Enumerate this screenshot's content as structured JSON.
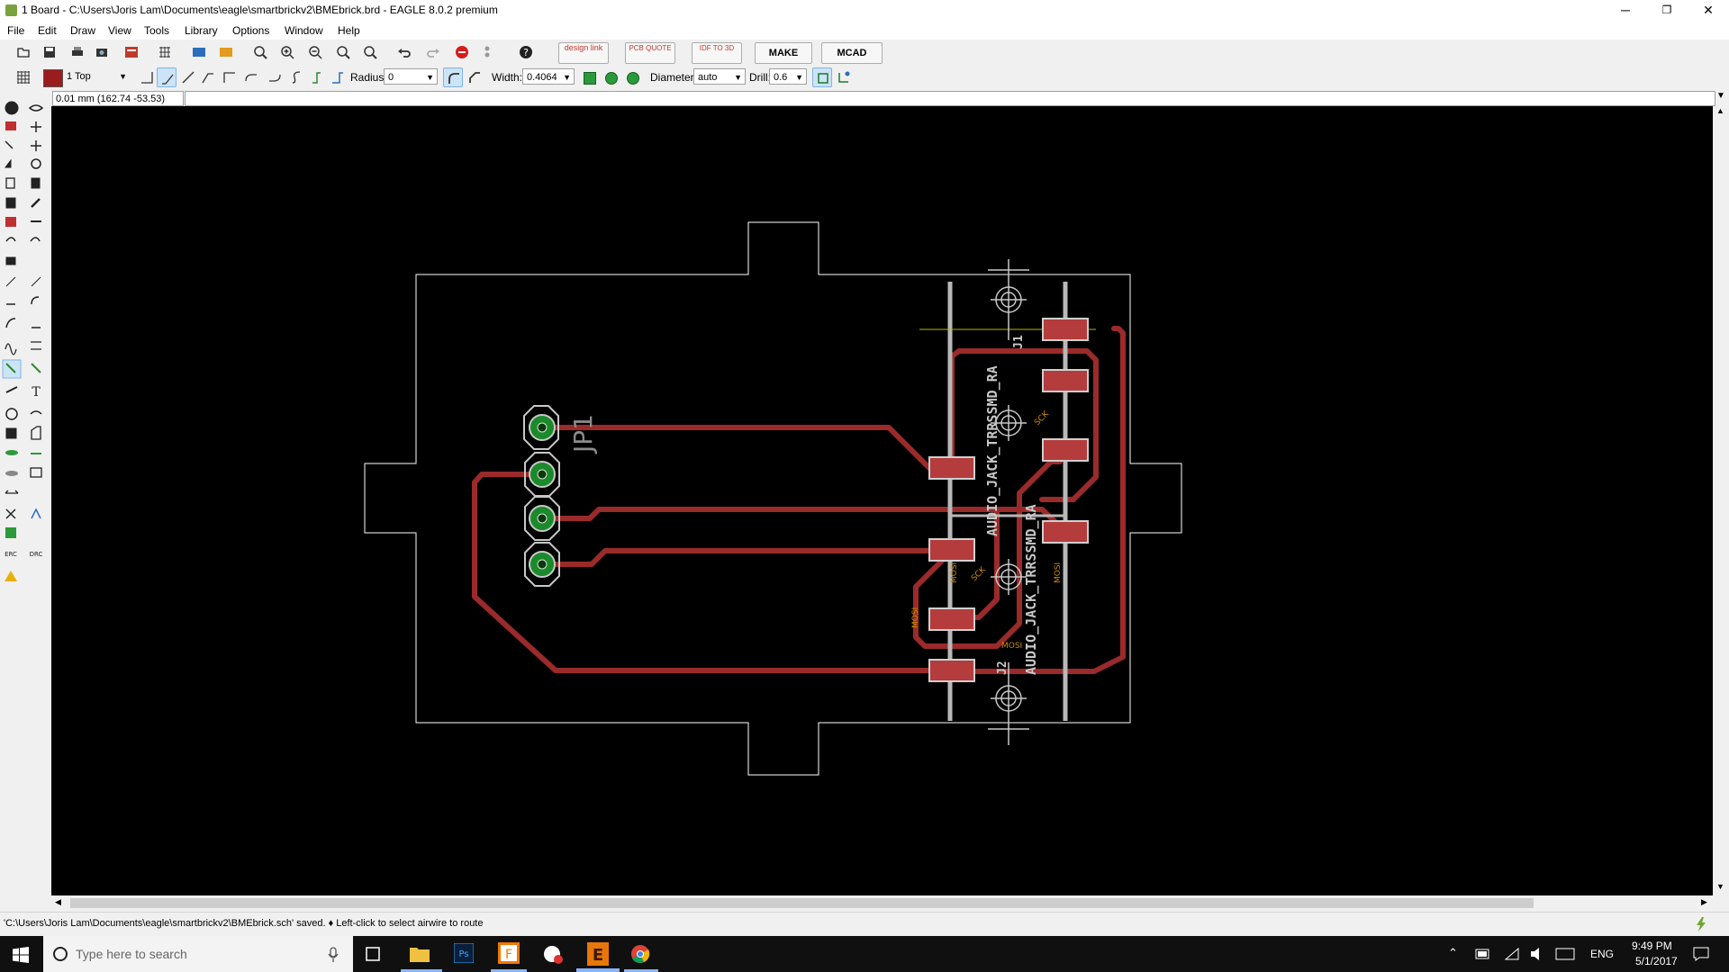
{
  "window": {
    "title": "1 Board - C:\\Users\\Joris Lam\\Documents\\eagle\\smartbrickv2\\BMEbrick.brd - EAGLE 8.0.2 premium",
    "minimize": "─",
    "restore": "❐",
    "close": "✕"
  },
  "menu": [
    {
      "label": "File"
    },
    {
      "label": "Edit"
    },
    {
      "label": "Draw"
    },
    {
      "label": "View"
    },
    {
      "label": "Tools"
    },
    {
      "label": "Library"
    },
    {
      "label": "Options"
    },
    {
      "label": "Window"
    },
    {
      "label": "Help"
    }
  ],
  "toolbar1": {
    "design_link": "design link",
    "pcb_quote": "PCB QUOTE",
    "idf_3d": "IDF TO 3D",
    "make": "MAKE",
    "mcad": "MCAD"
  },
  "toolbar2": {
    "layer": "1 Top",
    "radius_label": "Radius:",
    "radius_value": "0",
    "width_label": "Width:",
    "width_value": "0.4064",
    "diameter_label": "Diameter:",
    "diameter_value": "auto",
    "drill_label": "Drill:",
    "drill_value": "0.6"
  },
  "coords": "0.01 mm (162.74 -53.53)",
  "board": {
    "header_label": "JP1",
    "jack1_name": "J1",
    "jack1_value": "AUDIO_JACK_TRRSSMD_RA",
    "jack2_name": "J2",
    "jack2_value": "AUDIO_JACK_TRRSSMD_RA",
    "signal_sck": "SCK",
    "signal_mosi": "MOSI"
  },
  "colors": {
    "canvas": "#000000",
    "trace": "#9b2a2a",
    "pad_fill": "#b43c3c",
    "pad_ring": "#b0b0b0",
    "via_green": "#1a8a2a",
    "outline": "#ffffff",
    "silk": "#c8c8c8"
  },
  "status": "'C:\\Users\\Joris Lam\\Documents\\eagle\\smartbrickv2\\BMEbrick.sch' saved.  ♦ Left-click to select airwire to route",
  "taskbar": {
    "search_placeholder": "Type here to search",
    "lang": "ENG",
    "time": "9:49 PM",
    "date": "5/1/2017"
  }
}
